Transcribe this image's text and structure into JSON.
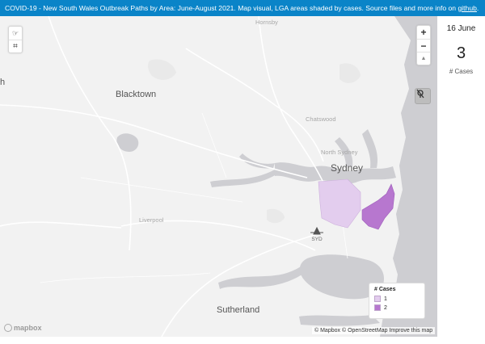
{
  "header": {
    "title_text": "COVID-19  - New South Wales Outbreak Paths by Area: June-August 2021.  Map visual, LGA areas shaded by cases. Source files and more info on ",
    "link_text": "github",
    "trailing": "."
  },
  "map": {
    "places": {
      "hornsby": "Hornsby",
      "blacktown": "Blacktown",
      "chatswood": "Chatswood",
      "north_sydney": "North Sydney",
      "sydney": "Sydney",
      "liverpool": "Liverpool",
      "sutherland": "Sutherland",
      "partial_left": "h"
    },
    "airport_label": "SYD",
    "controls": {
      "draw_point": "☞",
      "draw_polygon": "⌗",
      "zoom_in": "+",
      "zoom_out": "−",
      "compass": "▲"
    },
    "legend": {
      "title": "# Cases",
      "items": [
        {
          "label": "1",
          "color": "#e3cdee"
        },
        {
          "label": "2",
          "color": "#b777cf"
        }
      ]
    },
    "mapbox_label": "mapbox",
    "attribution": {
      "mapbox": "© Mapbox",
      "osm": "© OpenStreetMap",
      "improve": "Improve this map"
    },
    "colors": {
      "land": "#f2f2f2",
      "water": "#ceced2",
      "roads": "#ffffff",
      "lga_1": "#e3cdee",
      "lga_2": "#b777cf"
    }
  },
  "sidebar": {
    "date": "16 June",
    "count": "3",
    "count_label": "# Cases"
  }
}
